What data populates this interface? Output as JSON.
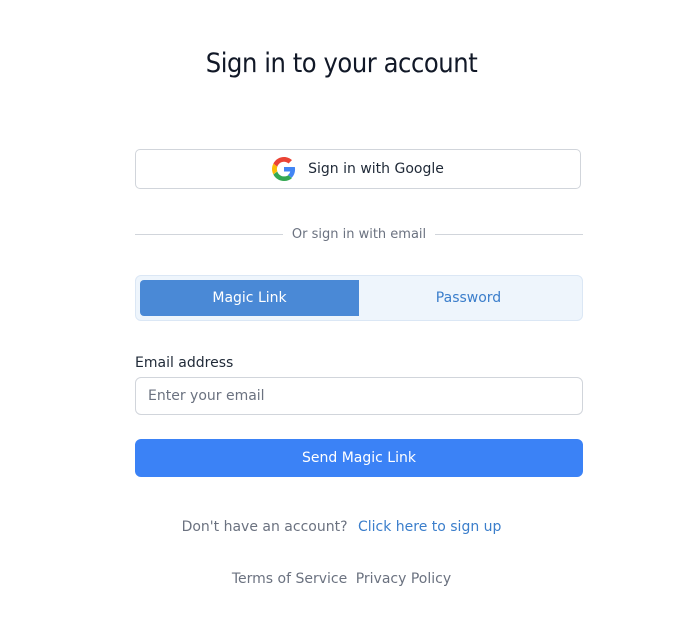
{
  "page": {
    "title": "Sign in to your account"
  },
  "google": {
    "label": "Sign in with Google",
    "icon": "google-icon"
  },
  "divider": {
    "text": "Or sign in with email"
  },
  "mode_toggle": {
    "options": [
      {
        "label": "Magic Link",
        "active": true
      },
      {
        "label": "Password",
        "active": false
      }
    ]
  },
  "email": {
    "label": "Email address",
    "value": "",
    "placeholder": "Enter your email"
  },
  "submit": {
    "label": "Send Magic Link"
  },
  "signup": {
    "prompt": "Don't have an account?",
    "link": "Click here to sign up"
  },
  "footer": {
    "terms": "Terms of Service",
    "privacy": "Privacy Policy"
  },
  "colors": {
    "primary": "#3b82f6",
    "toggle_active": "#4a89d6",
    "link": "#3b7ecb"
  }
}
